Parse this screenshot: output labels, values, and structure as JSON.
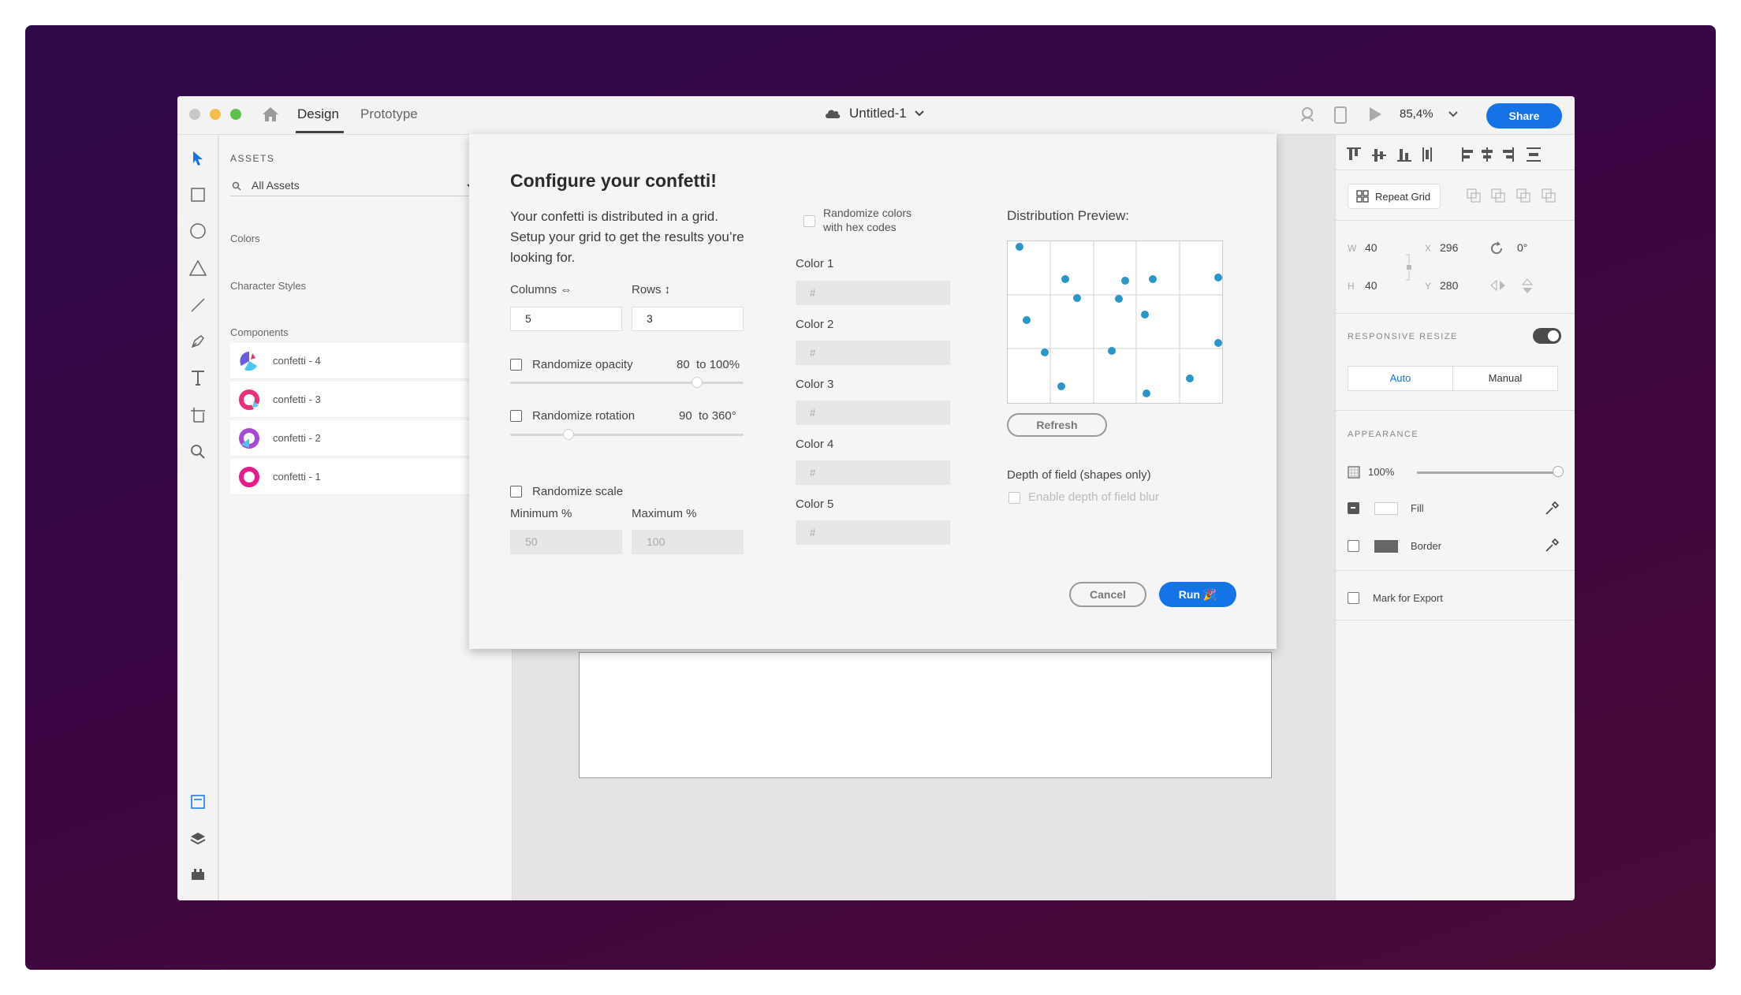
{
  "titlebar": {
    "tabs": [
      {
        "label": "Design",
        "active": true
      },
      {
        "label": "Prototype",
        "active": false
      }
    ],
    "document_title": "Untitled-1",
    "zoom": "85,4%",
    "share_label": "Share",
    "traffic_light_colors": [
      "#c8c8c8",
      "#f5bd4f",
      "#5ec34b"
    ],
    "icons": [
      "home-icon",
      "cloud-icon",
      "chevron-down-icon",
      "user-icon",
      "device-icon",
      "play-icon"
    ]
  },
  "toolbar": {
    "tools": [
      "select-icon",
      "rectangle-icon",
      "ellipse-icon",
      "polygon-icon",
      "line-icon",
      "pen-icon",
      "text-icon",
      "artboard-icon",
      "zoom-icon"
    ],
    "bottom": [
      "assets-icon",
      "layers-icon",
      "plugins-icon"
    ]
  },
  "assets": {
    "title": "ASSETS",
    "filter_value": "All Assets",
    "sections": {
      "colors": "Colors",
      "character_styles": "Character Styles",
      "components": "Components"
    },
    "components": [
      {
        "label": "confetti - 4",
        "color": "#6a5de0"
      },
      {
        "label": "confetti - 3",
        "color": "#e8317a"
      },
      {
        "label": "confetti - 2",
        "color": "#a84ad8"
      },
      {
        "label": "confetti - 1",
        "color": "#e81a8c"
      }
    ]
  },
  "inspector": {
    "repeat_grid_label": "Repeat Grid",
    "w_label": "W",
    "w_value": "40",
    "h_label": "H",
    "h_value": "40",
    "x_label": "X",
    "x_value": "296",
    "y_label": "Y",
    "y_value": "280",
    "rotation_value": "0°",
    "responsive_resize_label": "RESPONSIVE RESIZE",
    "responsive_resize_on": true,
    "resize_modes": [
      "Auto",
      "Manual"
    ],
    "appearance_label": "APPEARANCE",
    "opacity_value": "100%",
    "opacity_level": 1.0,
    "fill_label": "Fill",
    "border_label": "Border",
    "border_color": "#666666",
    "mark_export_label": "Mark for Export"
  },
  "modal": {
    "title": "Configure your confetti!",
    "description": "Your confetti is distributed in a grid. Setup your grid to get the results you’re looking for.",
    "columns_label": "Columns ⇔",
    "columns_value": "5",
    "rows_label": "Rows ↕",
    "rows_value": "3",
    "opacity": {
      "label": "Randomize opacity",
      "range": "80  to 100%",
      "level": 0.8
    },
    "rotation": {
      "label": "Randomize rotation",
      "range": "90  to 360°",
      "level": 0.25
    },
    "scale": {
      "label": "Randomize scale",
      "min_label": "Minimum %",
      "max_label": "Maximum %",
      "min_placeholder": "50",
      "max_placeholder": "100"
    },
    "hex_colors_label_1": "Randomize colors",
    "hex_colors_label_2": "with hex codes",
    "colors": [
      {
        "label": "Color 1",
        "placeholder": "#"
      },
      {
        "label": "Color 2",
        "placeholder": "#"
      },
      {
        "label": "Color 3",
        "placeholder": "#"
      },
      {
        "label": "Color 4",
        "placeholder": "#"
      },
      {
        "label": "Color 5",
        "placeholder": "#"
      }
    ],
    "preview_label": "Distribution Preview:",
    "preview_dot_color": "#2a96c8",
    "refresh_label": "Refresh",
    "depth_label": "Depth of field (shapes only)",
    "depth_blur_label": "Enable depth of field blur",
    "cancel_label": "Cancel",
    "run_label": "Run 🎉"
  }
}
